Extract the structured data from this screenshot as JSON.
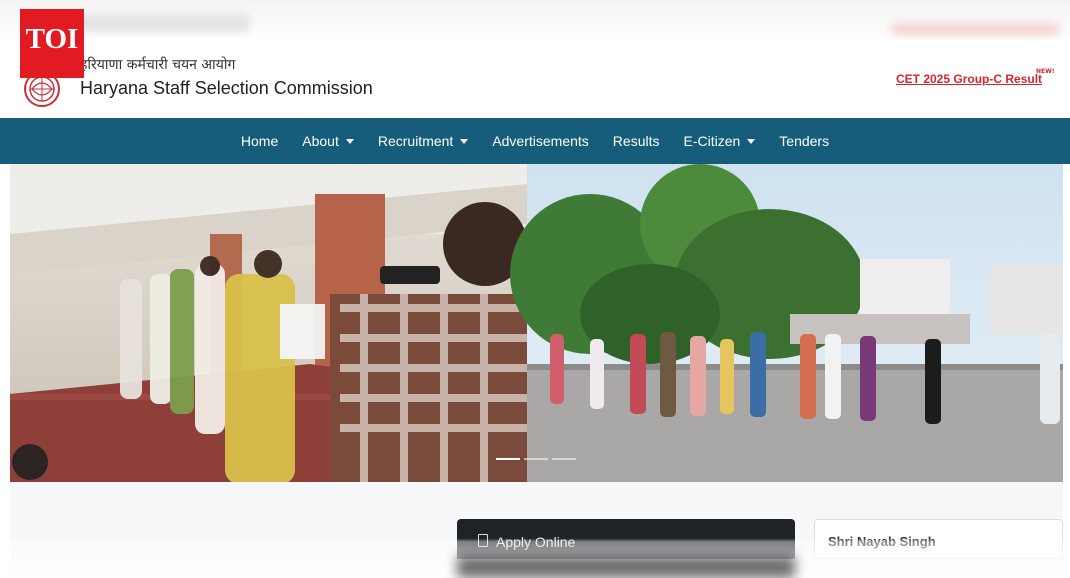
{
  "overlay": {
    "badge": "TOI"
  },
  "header": {
    "hindi_name": "हरियाणा कर्मचारी चयन आयोग",
    "org_name": "Haryana Staff Selection Commission",
    "announcement_link": "CET 2025 Group-C Result",
    "announcement_badge": "NEW!"
  },
  "nav": {
    "items": [
      {
        "label": "Home",
        "dropdown": false
      },
      {
        "label": "About",
        "dropdown": true
      },
      {
        "label": "Recruitment",
        "dropdown": true
      },
      {
        "label": "Advertisements",
        "dropdown": false
      },
      {
        "label": "Results",
        "dropdown": false
      },
      {
        "label": "E-Citizen",
        "dropdown": true
      },
      {
        "label": "Tenders",
        "dropdown": false
      }
    ]
  },
  "slider": {
    "slide_count": 3,
    "active_slide": 1
  },
  "cards": {
    "apply_title": "Apply Online",
    "side_title": "Shri Nayab Singh"
  },
  "colors": {
    "nav_bg": "#155d7a",
    "accent_red": "#d6262c",
    "badge_red": "#e21b22"
  }
}
